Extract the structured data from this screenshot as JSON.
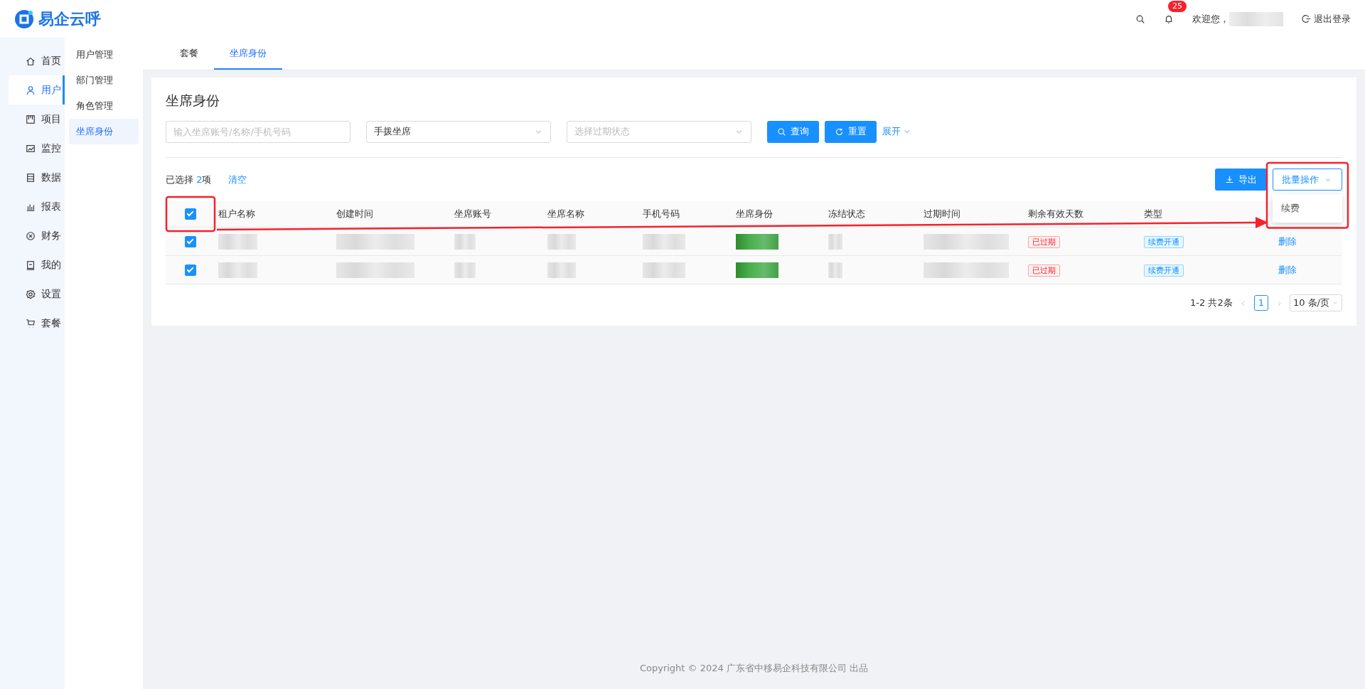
{
  "brand": {
    "name": "易企云呼"
  },
  "header": {
    "notification_count": "25",
    "welcome": "欢迎您，",
    "logout": "退出登录"
  },
  "nav": [
    {
      "label": "首页",
      "selected": false
    },
    {
      "label": "用户",
      "selected": true
    },
    {
      "label": "项目",
      "selected": false
    },
    {
      "label": "监控",
      "selected": false
    },
    {
      "label": "数据",
      "selected": false
    },
    {
      "label": "报表",
      "selected": false
    },
    {
      "label": "财务",
      "selected": false
    },
    {
      "label": "我的",
      "selected": false
    },
    {
      "label": "设置",
      "selected": false
    },
    {
      "label": "套餐",
      "selected": false
    }
  ],
  "subnav": [
    {
      "label": "用户管理",
      "selected": false
    },
    {
      "label": "部门管理",
      "selected": false
    },
    {
      "label": "角色管理",
      "selected": false
    },
    {
      "label": "坐席身份",
      "selected": true
    }
  ],
  "tabs": [
    {
      "label": "套餐",
      "selected": false
    },
    {
      "label": "坐席身份",
      "selected": true
    }
  ],
  "page_title": "坐席身份",
  "filters": {
    "search": {
      "placeholder": "输入坐席账号/名称/手机号码"
    },
    "seat_type": {
      "value": "手拨坐席"
    },
    "expiry_status": {
      "placeholder": "选择过期状态"
    },
    "query": "查询",
    "reset": "重置",
    "expand": "展开"
  },
  "selection": {
    "prefix": "已选择",
    "count": "2",
    "suffix": "项",
    "clear": "清空"
  },
  "export": "导出",
  "batch": {
    "label": "批量操作",
    "expanded": true,
    "menu": [
      "续费"
    ]
  },
  "table": {
    "all_checked": true,
    "columns": [
      "租户名称",
      "创建时间",
      "坐席账号",
      "坐席名称",
      "手机号码",
      "坐席身份",
      "冻结状态",
      "过期时间",
      "剩余有效天数",
      "类型"
    ],
    "rows": [
      {
        "checked": true,
        "status": "已过期",
        "type": "续费开通",
        "action": "删除"
      },
      {
        "checked": true,
        "status": "已过期",
        "type": "续费开通",
        "action": "删除"
      }
    ]
  },
  "pagination": {
    "summary": "1-2 共2条",
    "pages": [
      {
        "label": "1",
        "selected": true
      }
    ],
    "page_size": "10 条/页"
  },
  "footer": "Copyright © 2024 广东省中移易企科技有限公司 出品",
  "annotations": [
    {
      "kind": "box"
    },
    {
      "kind": "box"
    },
    {
      "kind": "arrow"
    }
  ]
}
